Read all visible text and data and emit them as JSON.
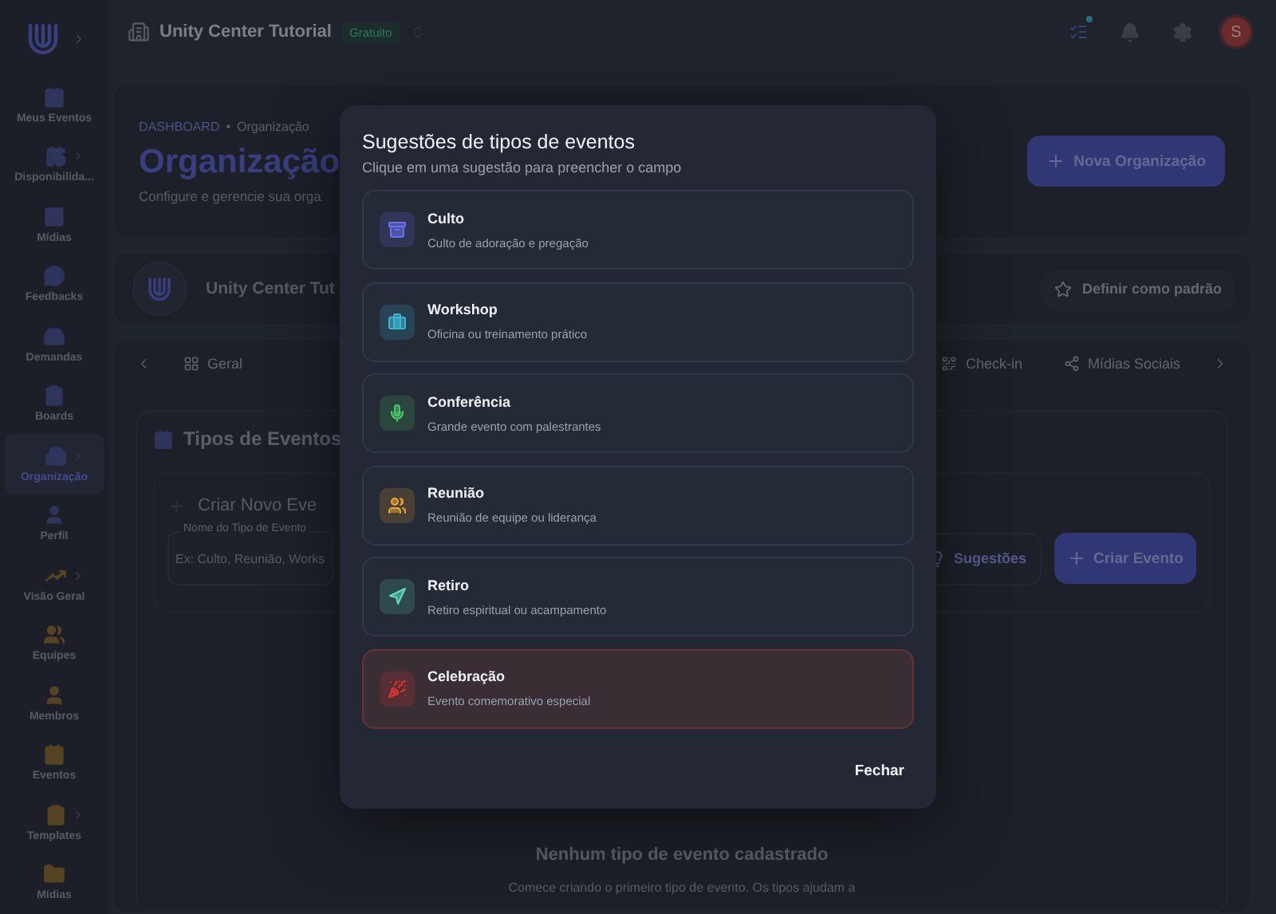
{
  "topbar": {
    "org_name": "Unity Center Tutorial",
    "plan_badge": "Gratuito",
    "avatar_initial": "S",
    "tasks_unread": true
  },
  "sidebar": {
    "items": [
      {
        "label": "Meus Eventos",
        "selected": false,
        "submenu": false
      },
      {
        "label": "Disponibilida...",
        "selected": false,
        "submenu": true
      },
      {
        "label": "Mídias",
        "selected": false,
        "submenu": false
      },
      {
        "label": "Feedbacks",
        "selected": false,
        "submenu": false
      },
      {
        "label": "Demandas",
        "selected": false,
        "submenu": false
      },
      {
        "label": "Boards",
        "selected": false,
        "submenu": false
      },
      {
        "label": "Organização",
        "selected": true,
        "submenu": true
      },
      {
        "label": "Perfil",
        "selected": false,
        "submenu": false
      },
      {
        "label": "Visão Geral",
        "selected": false,
        "submenu": true
      },
      {
        "label": "Equipes",
        "selected": false,
        "submenu": false
      },
      {
        "label": "Membros",
        "selected": false,
        "submenu": false
      },
      {
        "label": "Eventos",
        "selected": false,
        "submenu": false
      },
      {
        "label": "Templates",
        "selected": false,
        "submenu": true
      },
      {
        "label": "Mídias",
        "selected": false,
        "submenu": false
      }
    ]
  },
  "header": {
    "breadcrumb_root": "DASHBOARD",
    "breadcrumb_separator": "•",
    "breadcrumb_current": "Organização",
    "title": "Organização",
    "subtitle": "Configure e gerencie sua orga",
    "new_button": "Nova Organização"
  },
  "org_card": {
    "name": "Unity Center Tut",
    "default_button": "Definir como padrão"
  },
  "tabs": [
    {
      "label": "Geral",
      "selected": false
    },
    {
      "label": "Check-in",
      "selected": false
    },
    {
      "label": "Mídias Sociais",
      "selected": false
    }
  ],
  "event_types": {
    "title": "Tipos de Eventos",
    "create_title": "Criar Novo Eve",
    "field_label": "Nome do Tipo de Evento",
    "field_placeholder": "Ex: Culto, Reunião, Works",
    "suggestions_button": "Sugestões",
    "create_button": "Criar Evento",
    "empty_title": "Nenhum tipo de evento cadastrado",
    "empty_text": "Comece criando o primeiro tipo de evento. Os tipos ajudam a"
  },
  "dialog": {
    "title": "Sugestões de tipos de eventos",
    "subtitle": "Clique em uma sugestão para preencher o campo",
    "close_button": "Fechar",
    "suggestions": [
      {
        "name": "Culto",
        "description": "Culto de adoração e pregação",
        "color": "#6d6ff0",
        "selected": false
      },
      {
        "name": "Workshop",
        "description": "Oficina ou treinamento prático",
        "color": "#3cb8d6",
        "selected": false
      },
      {
        "name": "Conferência",
        "description": "Grande evento com palestrantes",
        "color": "#4cc86a",
        "selected": false
      },
      {
        "name": "Reunião",
        "description": "Reunião de equipe ou liderança",
        "color": "#f0a830",
        "selected": false
      },
      {
        "name": "Retiro",
        "description": "Retiro espiritual ou acampamento",
        "color": "#5ee0c0",
        "selected": false
      },
      {
        "name": "Celebração",
        "description": "Evento comemorativo especial",
        "color": "#e0342c",
        "selected": true
      }
    ]
  }
}
